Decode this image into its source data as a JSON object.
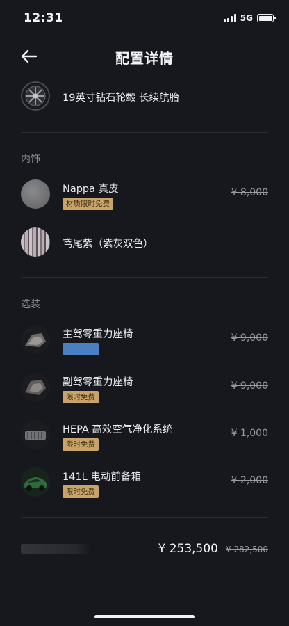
{
  "status_bar": {
    "time": "12:31",
    "network": "5G"
  },
  "nav": {
    "title": "配置详情"
  },
  "wheel": {
    "name": "19英寸钻石轮毂 长续航胎",
    "icon": "wheel-icon"
  },
  "interior": {
    "title": "内饰",
    "items": [
      {
        "name": "Nappa 真皮",
        "tag": "材质限时免费",
        "price": "¥ 8,000",
        "icon": "leather-swatch"
      },
      {
        "name": "鸢尾紫（紫灰双色）",
        "icon": "color-swatch"
      }
    ]
  },
  "options": {
    "title": "选装",
    "items": [
      {
        "name": "主驾零重力座椅",
        "tag": "",
        "price": "¥ 9,000",
        "icon": "seat-thumbnail"
      },
      {
        "name": "副驾零重力座椅",
        "tag": "限时免费",
        "price": "¥ 9,000",
        "icon": "seat-thumbnail"
      },
      {
        "name": "HEPA 高效空气净化系统",
        "tag": "限时免费",
        "price": "¥ 1,000",
        "icon": "air-purifier-thumbnail"
      },
      {
        "name": "141L 电动前备箱",
        "tag": "限时免费",
        "price": "¥ 2,000",
        "icon": "frunk-thumbnail"
      }
    ]
  },
  "summary": {
    "price": "¥ 253,500",
    "original_price": "¥ 282,500"
  },
  "colors": {
    "background": "#16181d",
    "tag": "#c9a46a",
    "tag_text": "#3b2c10"
  }
}
